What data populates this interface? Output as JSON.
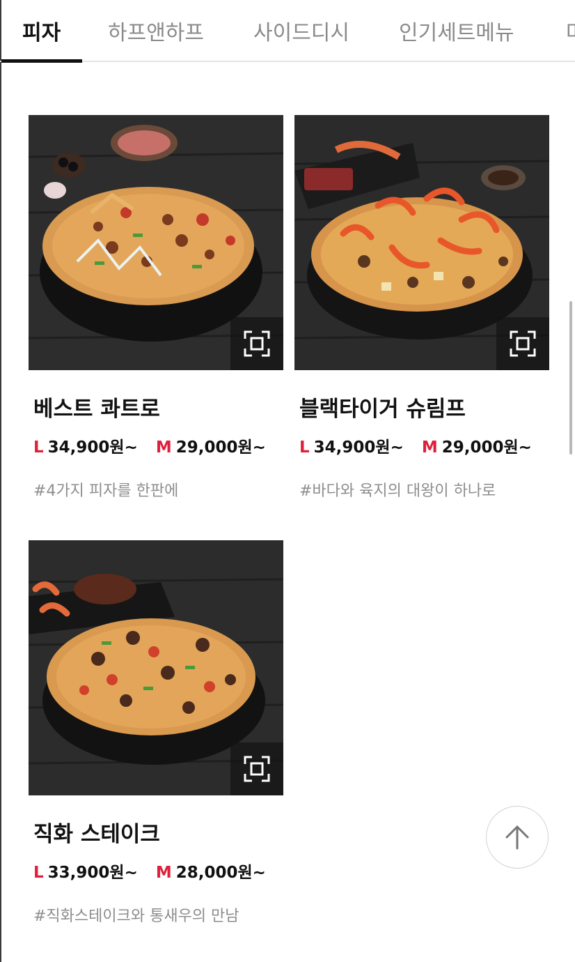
{
  "tabs": [
    {
      "label": "피자",
      "active": true
    },
    {
      "label": "하프앤하프",
      "active": false
    },
    {
      "label": "사이드디시",
      "active": false
    },
    {
      "label": "인기세트메뉴",
      "active": false
    },
    {
      "label": "마",
      "active": false
    }
  ],
  "products": [
    {
      "name": "베스트 콰트로",
      "sizes": [
        {
          "size": "L",
          "price": "34,900원~"
        },
        {
          "size": "M",
          "price": "29,000원~"
        }
      ],
      "tag": "#4가지 피자를 한판에"
    },
    {
      "name": "블랙타이거 슈림프",
      "sizes": [
        {
          "size": "L",
          "price": "34,900원~"
        },
        {
          "size": "M",
          "price": "29,000원~"
        }
      ],
      "tag": "#바다와 육지의 대왕이 하나로"
    },
    {
      "name": "직화 스테이크",
      "sizes": [
        {
          "size": "L",
          "price": "33,900원~"
        },
        {
          "size": "M",
          "price": "28,000원~"
        }
      ],
      "tag": "#직화스테이크와 통새우의 만남"
    }
  ],
  "icons": {
    "zoom": "expand-frame-icon",
    "scroll_top": "arrow-up-icon"
  },
  "colors": {
    "size_label": "#e0203a",
    "active_tab": "#111111",
    "inactive_tab": "#8a8a8a",
    "tag_text": "#8d8d8d"
  }
}
